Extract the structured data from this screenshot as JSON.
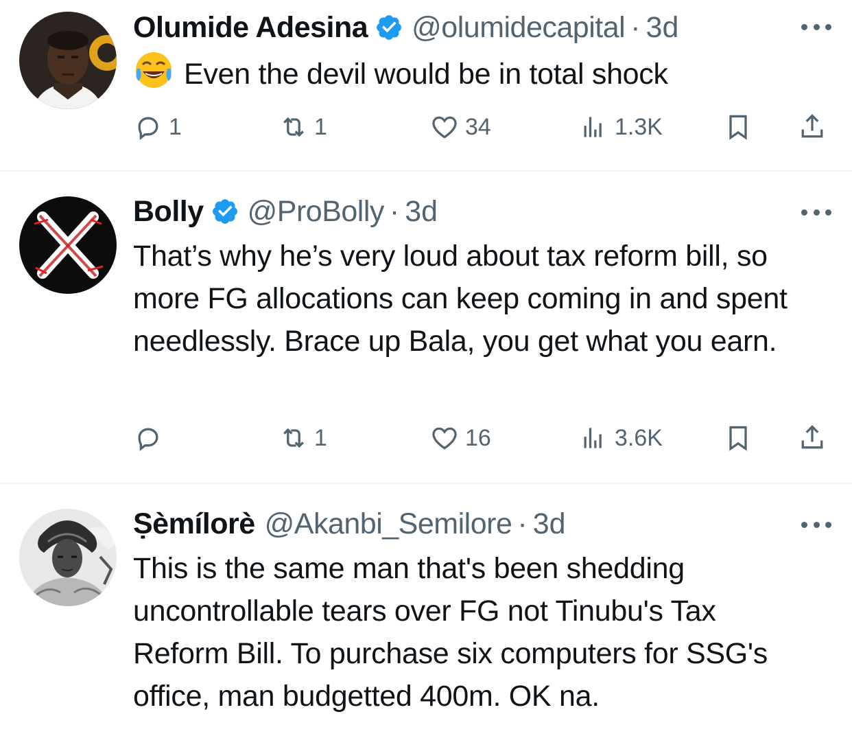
{
  "tweets": [
    {
      "name": "Olumide Adesina",
      "verified": true,
      "handle": "@olumidecapital",
      "separator": "·",
      "time": "3d",
      "emoji": "face-with-tears-of-joy",
      "text": "Even the devil would be in total shock",
      "replies": "1",
      "retweets": "1",
      "likes": "34",
      "views": "1.3K"
    },
    {
      "name": "Bolly",
      "verified": true,
      "handle": "@ProBolly",
      "separator": "·",
      "time": "3d",
      "text": "That’s why he’s very loud about tax reform bill, so more FG allocations can keep coming in and spent needlessly. Brace up Bala, you get what you earn.",
      "replies": "",
      "retweets": "1",
      "likes": "16",
      "views": "3.6K"
    },
    {
      "name": "Ṣèmílorè",
      "verified": false,
      "handle": "@Akanbi_Semilore",
      "separator": "·",
      "time": "3d",
      "text": "This is the same man that's been shedding uncontrollable tears over FG not Tinubu's Tax Reform Bill. To purchase six computers for SSG's office, man budgetted 400m. OK na."
    }
  ],
  "colors": {
    "text_primary": "#0f1419",
    "text_secondary": "#536471",
    "verified_blue": "#1d9bf0",
    "divider": "#eff3f4"
  }
}
